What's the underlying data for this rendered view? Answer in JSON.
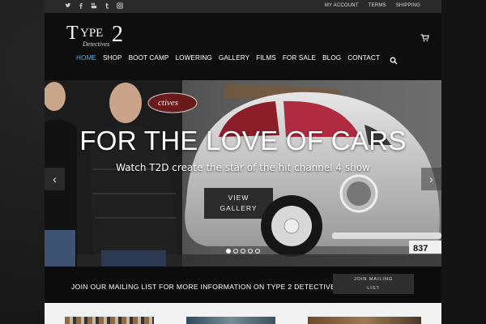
{
  "topbar": {
    "social_icons": [
      "twitter-icon",
      "facebook-icon",
      "youtube-icon",
      "tumblr-icon",
      "instagram-icon"
    ],
    "links": [
      "MY ACCOUNT",
      "TERMS",
      "SHIPPING"
    ]
  },
  "logo": {
    "t": "T",
    "ype": "YPE",
    "two": "2",
    "detectives": "Detectives"
  },
  "nav": {
    "items": [
      "HOME",
      "SHOP",
      "BOOT CAMP",
      "LOWERING",
      "GALLERY",
      "FILMS",
      "FOR SALE",
      "BLOG",
      "CONTACT"
    ],
    "active": "HOME"
  },
  "hero": {
    "title": "FOR THE LOVE OF CARS",
    "subtitle": "Watch T2D create the star of the hit channel 4 show",
    "button_line1": "VIEW",
    "button_line2": "GALLERY",
    "slide_count": 5,
    "active_slide": 1,
    "plate": "837",
    "sign": "ctives"
  },
  "mailing": {
    "text": "JOIN OUR MAILING LIST FOR MORE INFORMATION ON TYPE 2 DETECTIVES",
    "button_line1": "JOIN MAILING",
    "button_line2": "LIST"
  },
  "colors": {
    "accent": "#5aa7d8",
    "header_bg": "#0e0e0e",
    "topbar_bg": "#2a2a2a"
  }
}
